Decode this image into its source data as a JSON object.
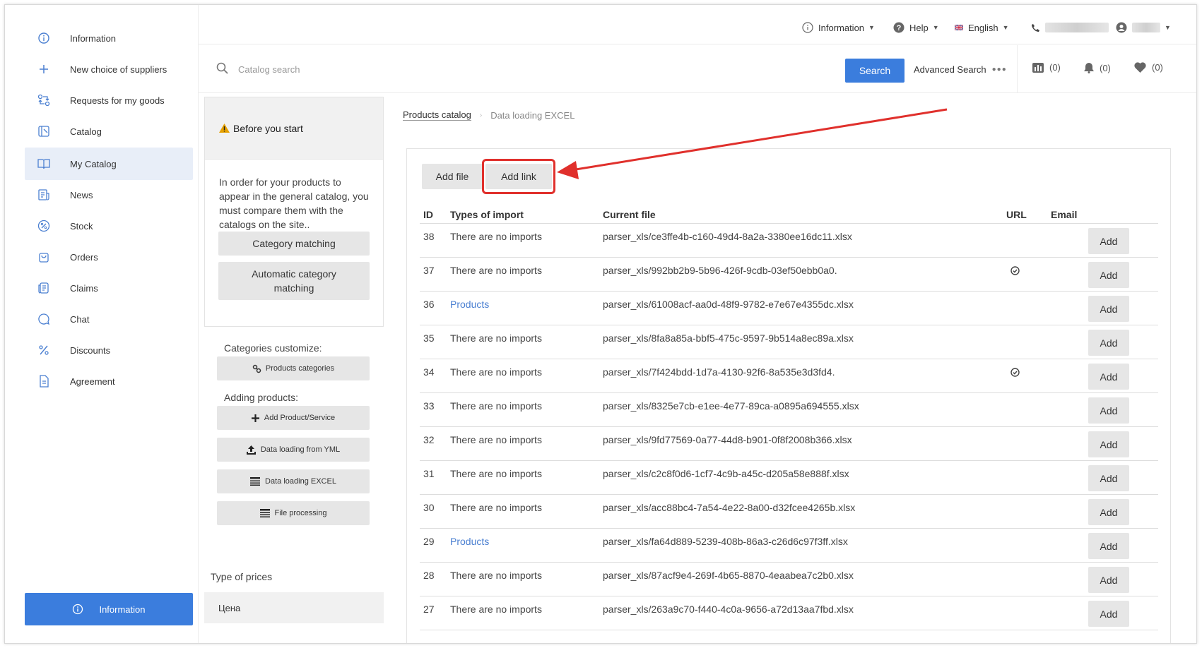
{
  "sidebar": {
    "items": [
      {
        "label": "Information",
        "icon": "info-circle-icon"
      },
      {
        "label": "New choice of suppliers",
        "icon": "plus-icon"
      },
      {
        "label": "Requests for my goods",
        "icon": "exchange-icon"
      },
      {
        "label": "Catalog",
        "icon": "catalog-icon"
      },
      {
        "label": "My Catalog",
        "icon": "book-open-icon",
        "active": true
      },
      {
        "label": "News",
        "icon": "news-icon"
      },
      {
        "label": "Stock",
        "icon": "percent-badge-icon"
      },
      {
        "label": "Orders",
        "icon": "shopping-bag-icon"
      },
      {
        "label": "Claims",
        "icon": "claims-icon"
      },
      {
        "label": "Chat",
        "icon": "chat-icon"
      },
      {
        "label": "Discounts",
        "icon": "percent-icon"
      },
      {
        "label": "Agreement",
        "icon": "document-icon"
      }
    ],
    "info_button": "Information"
  },
  "topbar": {
    "information": "Information",
    "help": "Help",
    "language": "English"
  },
  "search": {
    "placeholder": "Catalog search",
    "button": "Search",
    "advanced": "Advanced Search",
    "compare_count": "(0)",
    "notifications_count": "(0)",
    "favorites_count": "(0)"
  },
  "panel": {
    "title": "Before you start",
    "text": "In order for your products to appear in the general catalog, you must compare them with the catalogs on the site..",
    "category_matching": "Category matching",
    "auto_category_matching": "Automatic category matching",
    "categories_customize": "Categories customize:",
    "products_categories": "Products categories",
    "adding_products": "Adding products:",
    "add_product": "Add Product/Service",
    "data_loading_yml": "Data loading from YML",
    "data_loading_excel": "Data loading EXCEL",
    "file_processing": "File processing",
    "type_of_prices": "Type of prices",
    "price_name": "Цена"
  },
  "breadcrumb": {
    "parent": "Products catalog",
    "current": "Data loading EXCEL"
  },
  "main": {
    "add_file": "Add file",
    "add_link": "Add link",
    "highlight_color": "#e0302c",
    "columns": {
      "id": "ID",
      "type": "Types of import",
      "file": "Current file",
      "url": "URL",
      "email": "Email"
    },
    "add_label": "Add",
    "rows": [
      {
        "id": "38",
        "type": "There are no imports",
        "file": "parser_xls/ce3ffe4b-c160-49d4-8a2a-3380ee16dc11.xlsx",
        "url": false
      },
      {
        "id": "37",
        "type": "There are no imports",
        "file": "parser_xls/992bb2b9-5b96-426f-9cdb-03ef50ebb0a0.",
        "url": true
      },
      {
        "id": "36",
        "type": "Products",
        "file": "parser_xls/61008acf-aa0d-48f9-9782-e7e67e4355dc.xlsx",
        "url": false,
        "link": true
      },
      {
        "id": "35",
        "type": "There are no imports",
        "file": "parser_xls/8fa8a85a-bbf5-475c-9597-9b514a8ec89a.xlsx",
        "url": false
      },
      {
        "id": "34",
        "type": "There are no imports",
        "file": "parser_xls/7f424bdd-1d7a-4130-92f6-8a535e3d3fd4.",
        "url": true
      },
      {
        "id": "33",
        "type": "There are no imports",
        "file": "parser_xls/8325e7cb-e1ee-4e77-89ca-a0895a694555.xlsx",
        "url": false
      },
      {
        "id": "32",
        "type": "There are no imports",
        "file": "parser_xls/9fd77569-0a77-44d8-b901-0f8f2008b366.xlsx",
        "url": false
      },
      {
        "id": "31",
        "type": "There are no imports",
        "file": "parser_xls/c2c8f0d6-1cf7-4c9b-a45c-d205a58e888f.xlsx",
        "url": false
      },
      {
        "id": "30",
        "type": "There are no imports",
        "file": "parser_xls/acc88bc4-7a54-4e22-8a00-d32fcee4265b.xlsx",
        "url": false
      },
      {
        "id": "29",
        "type": "Products",
        "file": "parser_xls/fa64d889-5239-408b-86a3-c26d6c97f3ff.xlsx",
        "url": false,
        "link": true
      },
      {
        "id": "28",
        "type": "There are no imports",
        "file": "parser_xls/87acf9e4-269f-4b65-8870-4eaabea7c2b0.xlsx",
        "url": false
      },
      {
        "id": "27",
        "type": "There are no imports",
        "file": "parser_xls/263a9c70-f440-4c0a-9656-a72d13aa7fbd.xlsx",
        "url": false
      }
    ]
  }
}
